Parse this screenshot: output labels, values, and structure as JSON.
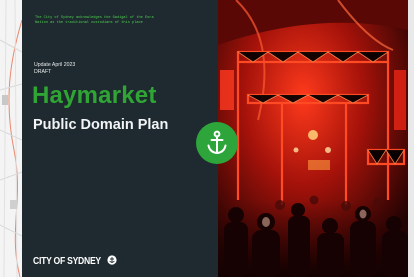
{
  "cover": {
    "acknowledgement": "The City of Sydney acknowledges the Gadigal of the Eora Nation as the traditional custodians of this place",
    "update": "Update April 2023",
    "status": "DRAFT",
    "title": "Haymarket",
    "subtitle": "Public Domain Plan"
  },
  "brand": {
    "name": "CITY OF SYDNEY",
    "icon": "anchor-crest-icon"
  },
  "badge": {
    "icon": "anchor-icon"
  },
  "colors": {
    "panel": "#1e2a30",
    "accent_green": "#2fa534",
    "photo_red": "#e0160f"
  }
}
